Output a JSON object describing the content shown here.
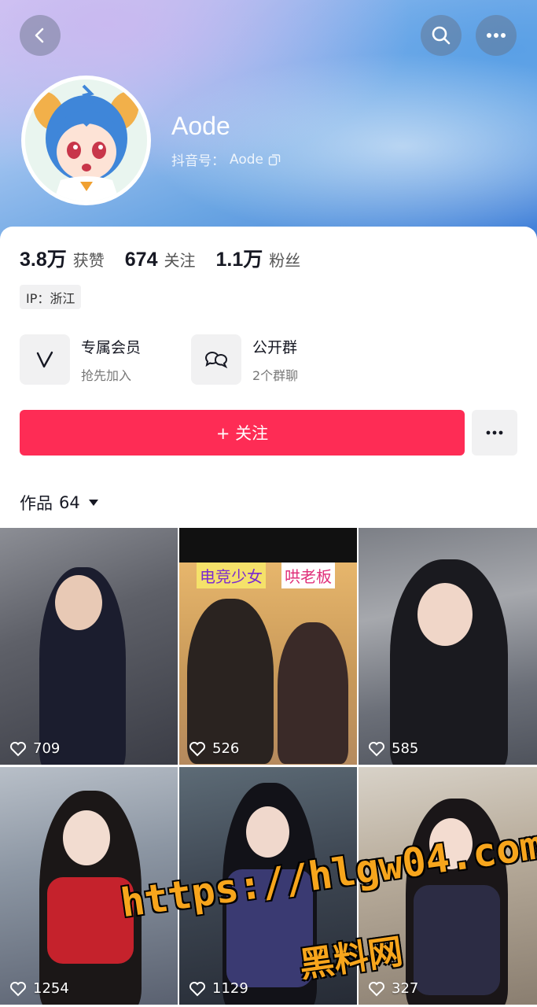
{
  "header": {
    "username": "Aode",
    "douyin_id_label": "抖音号：",
    "douyin_id_value": "Aode"
  },
  "stats": [
    {
      "num": "3.8万",
      "label": "获赞"
    },
    {
      "num": "674",
      "label": "关注"
    },
    {
      "num": "1.1万",
      "label": "粉丝"
    }
  ],
  "ip": "IP：浙江",
  "features": {
    "membership": {
      "title": "专属会员",
      "subtitle": "抢先加入"
    },
    "group": {
      "title": "公开群",
      "subtitle": "2个群聊"
    }
  },
  "actions": {
    "follow_label": "+ 关注"
  },
  "works_tab": {
    "label": "作品",
    "count": "64"
  },
  "videos": [
    {
      "likes": "709"
    },
    {
      "likes": "526",
      "tags": [
        "电竞少女",
        "哄老板"
      ]
    },
    {
      "likes": "585"
    },
    {
      "likes": "1254"
    },
    {
      "likes": "1129"
    },
    {
      "likes": "327"
    }
  ],
  "watermark": {
    "url": "https://hlgw04.com",
    "name": "黑料网"
  },
  "colors": {
    "primary": "#fe2c55",
    "text": "#161823",
    "secondary_bg": "#f1f1f2"
  },
  "icons": {
    "back": "chevron-left-icon",
    "search": "search-icon",
    "more": "more-horizontal-icon",
    "copy": "copy-icon",
    "membership": "v-logo-icon",
    "group": "chat-bubbles-icon",
    "dropdown": "caret-down-icon",
    "like": "heart-icon"
  }
}
